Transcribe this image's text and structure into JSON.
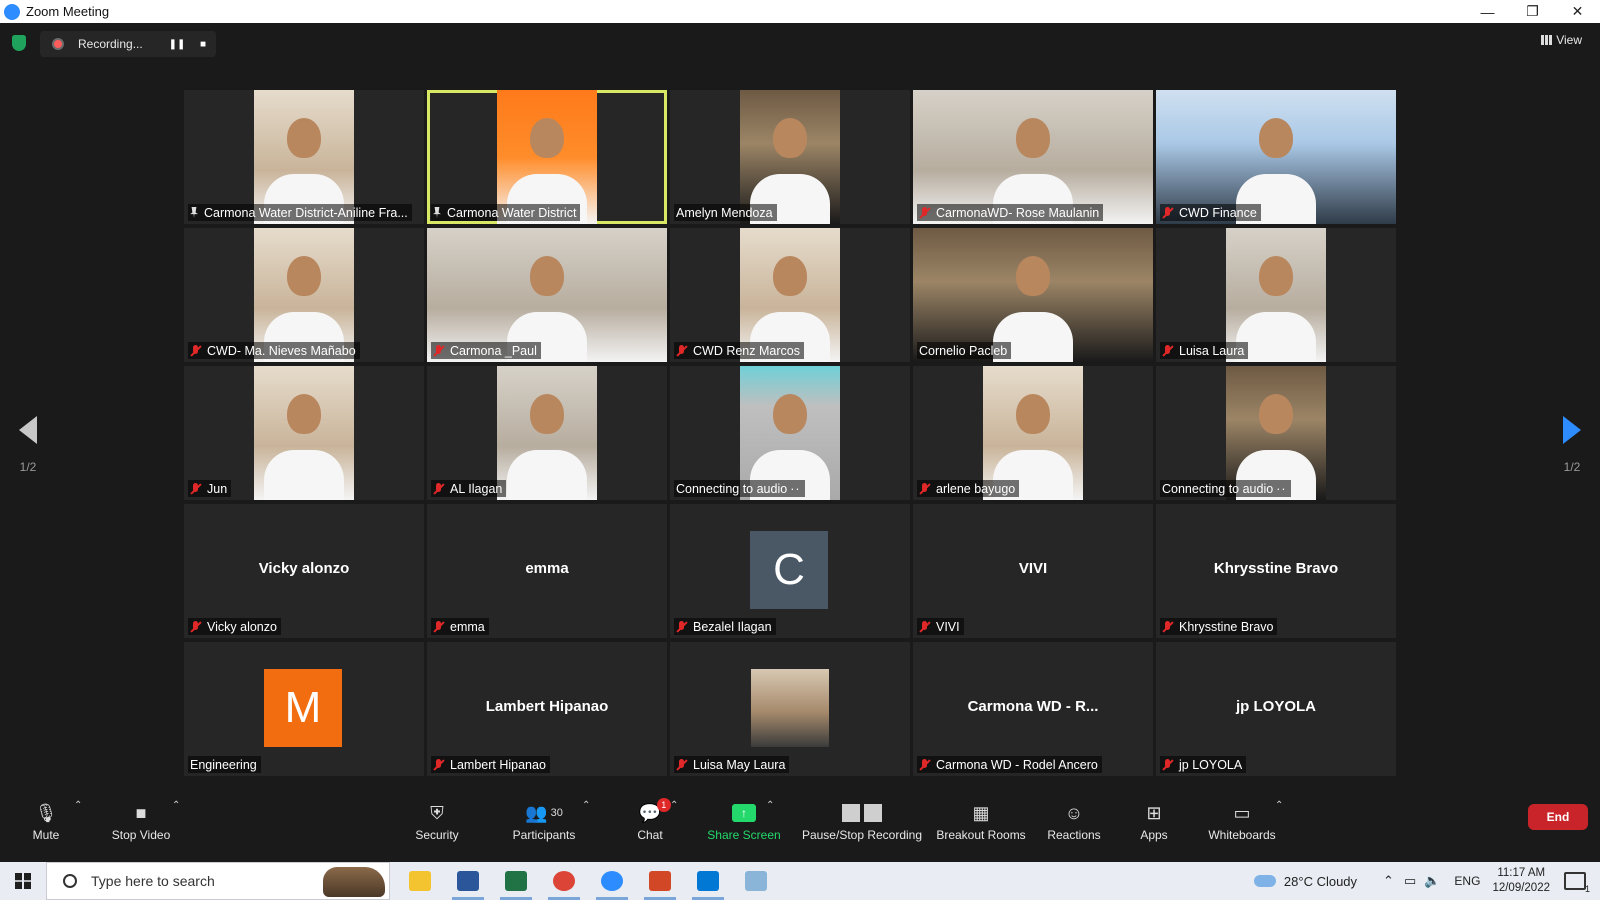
{
  "window": {
    "title": "Zoom Meeting",
    "minimize": "—",
    "restore": "❐",
    "close": "✕"
  },
  "recording": {
    "label": "Recording...",
    "pause": "❚❚",
    "stop": "■"
  },
  "view": {
    "label": "View"
  },
  "pager": {
    "left": "1/2",
    "right": "1/2"
  },
  "tiles": [
    {
      "name": "Carmona Water District-Aniline Fra...",
      "status": "pinned"
    },
    {
      "name": "Carmona Water District",
      "status": "pinned",
      "active": true
    },
    {
      "name": "Amelyn Mendoza",
      "status": "unmuted"
    },
    {
      "name": "CarmonaWD- Rose Maulanin",
      "status": "muted"
    },
    {
      "name": "CWD Finance",
      "status": "muted"
    },
    {
      "name": "CWD- Ma. Nieves Mañabo",
      "status": "muted"
    },
    {
      "name": "Carmona _Paul",
      "status": "muted"
    },
    {
      "name": "CWD Renz Marcos",
      "status": "muted"
    },
    {
      "name": "Cornelio Pacleb",
      "status": "unmuted"
    },
    {
      "name": "Luisa Laura",
      "status": "muted"
    },
    {
      "name": "Jun",
      "status": "muted"
    },
    {
      "name": "AL Ilagan",
      "status": "muted"
    },
    {
      "name": "Connecting to audio",
      "status": "connecting"
    },
    {
      "name": "arlene bayugo",
      "status": "muted"
    },
    {
      "name": "Connecting to audio",
      "status": "connecting"
    },
    {
      "name": "Vicky alonzo",
      "display": "Vicky alonzo",
      "status": "muted"
    },
    {
      "name": "emma",
      "display": "emma",
      "status": "muted"
    },
    {
      "name": "Bezalel Ilagan",
      "letter": "C",
      "letter_color": "#4a5866",
      "status": "muted"
    },
    {
      "name": "VIVI",
      "display": "VIVI",
      "status": "muted"
    },
    {
      "name": "Khrysstine Bravo",
      "display": "Khrysstine Bravo",
      "status": "muted"
    },
    {
      "name": "Engineering",
      "letter": "M",
      "letter_color": "#f26d0f",
      "status": "unmuted"
    },
    {
      "name": "Lambert Hipanao",
      "display": "Lambert Hipanao",
      "status": "muted"
    },
    {
      "name": "Luisa May Laura",
      "status": "muted"
    },
    {
      "name": "Carmona WD - Rodel Ancero",
      "display": "Carmona WD - R...",
      "status": "muted"
    },
    {
      "name": "jp LOYOLA",
      "display": "jp LOYOLA",
      "status": "muted"
    }
  ],
  "connecting_dots": "··",
  "toolbar": {
    "mute": "Mute",
    "stop_video": "Stop Video",
    "security": "Security",
    "participants": "Participants",
    "participants_count": "30",
    "chat": "Chat",
    "chat_badge": "1",
    "share_screen": "Share Screen",
    "pause_stop_recording": "Pause/Stop Recording",
    "breakout_rooms": "Breakout Rooms",
    "reactions": "Reactions",
    "apps": "Apps",
    "whiteboards": "Whiteboards",
    "end": "End",
    "caret": "⌃"
  },
  "taskbar": {
    "search_placeholder": "Type here to search",
    "weather": "28°C  Cloudy",
    "language": "ENG",
    "time": "11:17 AM",
    "date": "12/09/2022",
    "notifications_count": "1",
    "apps": [
      {
        "icon": "file-explorer-icon",
        "color": "#f4c430"
      },
      {
        "icon": "word-icon",
        "color": "#2b579a"
      },
      {
        "icon": "excel-icon",
        "color": "#217346"
      },
      {
        "icon": "chrome-icon",
        "color": "#db4437"
      },
      {
        "icon": "zoom-icon",
        "color": "#2d8cff"
      },
      {
        "icon": "powerpoint-icon",
        "color": "#d24726"
      },
      {
        "icon": "photos-icon",
        "color": "#0078d4"
      },
      {
        "icon": "paint-icon",
        "color": "#8ab4d8"
      }
    ]
  },
  "colors": {
    "accent_green": "#23d96b",
    "active_speaker": "#d8e864",
    "end_red": "#c9242a",
    "muted_red": "#e02828"
  }
}
